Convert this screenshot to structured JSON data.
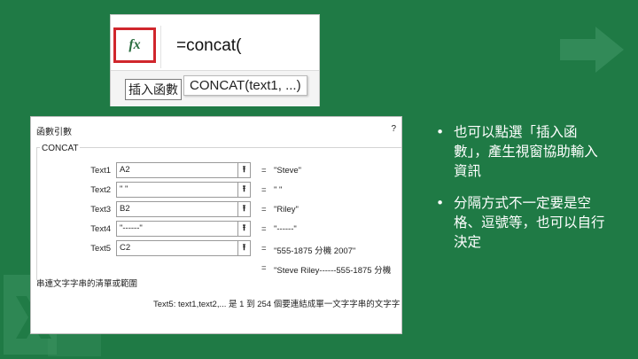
{
  "formula_bar": {
    "fx_icon": "fx",
    "input_value": "=concat(",
    "tooltip_insert": "插入函數",
    "tooltip_signature": "CONCAT(text1, ...)",
    "icon_box_color": "#d0262c"
  },
  "dialog": {
    "title": "函數引數",
    "help": "?",
    "function_name": "CONCAT",
    "args": [
      {
        "label": "Text1",
        "value": "A2",
        "result": "\"Steve\""
      },
      {
        "label": "Text2",
        "value": "\" \"",
        "result": "\" \""
      },
      {
        "label": "Text3",
        "value": "B2",
        "result": "\"Riley\""
      },
      {
        "label": "Text4",
        "value": "\"------\"",
        "result": "\"------\""
      },
      {
        "label": "Text5",
        "value": "C2",
        "result": "\"555-1875 分機 2007\""
      }
    ],
    "eq": "=",
    "ref_button": "⭱",
    "result": "\"Steve Riley------555-1875 分機",
    "description": "串連文字字串的清單或範圍",
    "detail": "Text5:  text1,text2,... 是 1 到 254 個要連結成單一文字字串的文字字"
  },
  "bullets": [
    {
      "marker": "•",
      "text": "也可以點選「插入函數」，產生視窗協助輸入資訊"
    },
    {
      "marker": "•",
      "text": "分隔方式不一定要是空格、逗號等，也可以自行決定"
    }
  ],
  "colors": {
    "background": "#1f7a45",
    "text": "#ffffff"
  }
}
